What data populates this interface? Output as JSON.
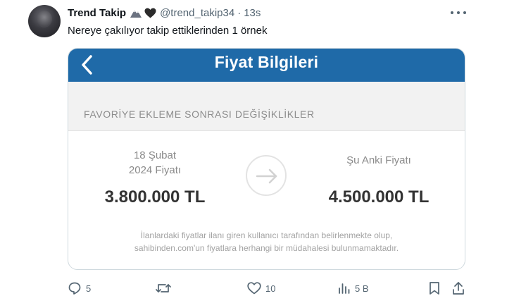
{
  "tweet": {
    "display_name": "Trend Takip",
    "handle": "@trend_takip34",
    "separator": "·",
    "time": "13s",
    "text": "Nereye çakılıyor takip ettiklerinden 1 örnek"
  },
  "media": {
    "app_title": "Fiyat Bilgileri",
    "section_title": "FAVORİYE EKLEME SONRASI DEĞİŞİKLİKLER",
    "old_label_line1": "18 Şubat",
    "old_label_line2": "2024 Fiyatı",
    "old_price": "3.800.000 TL",
    "new_label": "Şu Anki Fiyatı",
    "new_price": "4.500.000 TL",
    "disclaimer_line1": "İlanlardaki fiyatlar ilanı giren kullanıcı tarafından belirlenmekte olup,",
    "disclaimer_line2": "sahibinden.com'un fiyatlara herhangi bir müdahalesi bulunmamaktadır.",
    "colors": {
      "app_bar": "#1f6aa8",
      "price": "#333333",
      "muted": "#8a8a8a"
    }
  },
  "actions": {
    "reply_count": "5",
    "repost_count": "",
    "like_count": "10",
    "views_count": "5 B"
  },
  "icons": [
    "avatar",
    "mountain-emoji-icon",
    "black-heart-icon",
    "more-icon",
    "back-chevron-icon",
    "arrow-right-icon",
    "reply-icon",
    "repost-icon",
    "like-icon",
    "views-icon",
    "bookmark-icon",
    "share-icon"
  ]
}
